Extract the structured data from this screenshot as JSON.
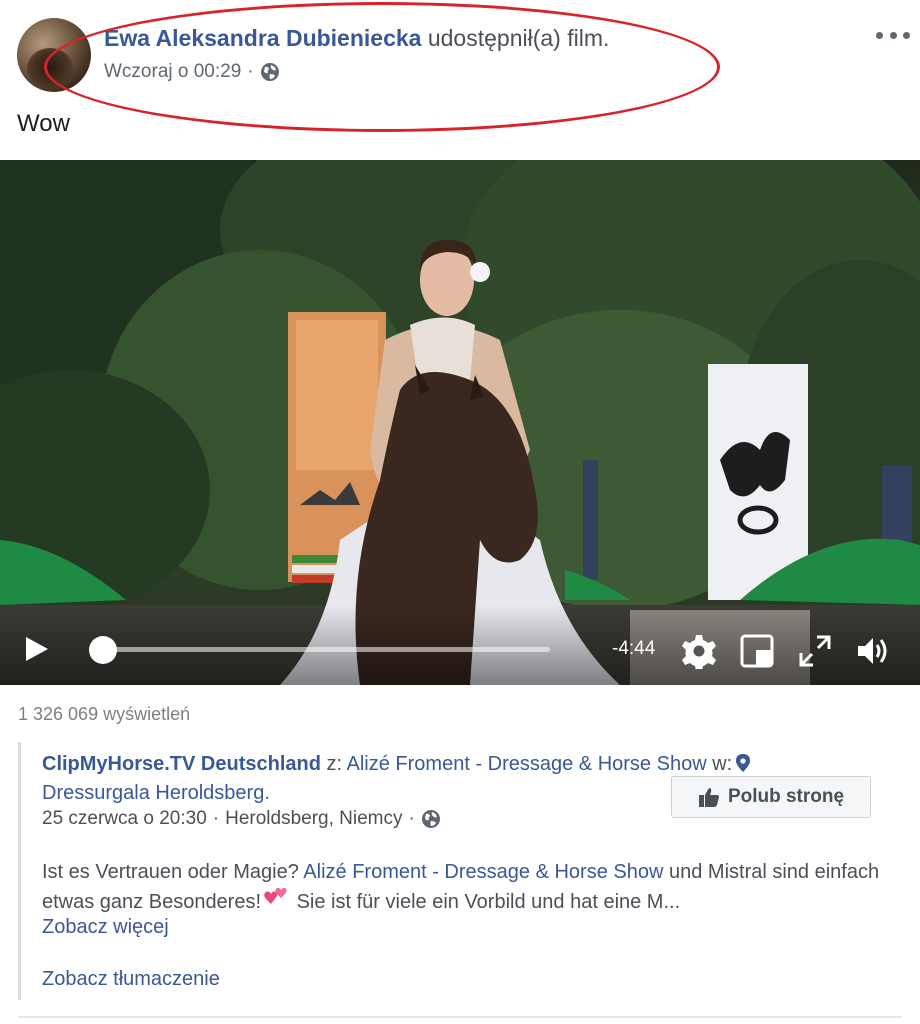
{
  "post": {
    "author": "Ewa Aleksandra Dubieniecka",
    "action": "udostępnił(a) film.",
    "timestamp": "Wczoraj o 00:29",
    "separator": "·",
    "privacy_icon": "globe-icon",
    "text": "Wow"
  },
  "video": {
    "time_remaining": "-4:44",
    "progress_fraction": 0.0,
    "icons": [
      "play-icon",
      "settings-icon",
      "picture-in-picture-icon",
      "fullscreen-icon",
      "volume-icon"
    ]
  },
  "views": "1 326 069 wyświetleń",
  "shared": {
    "page_name": "ClipMyHorse.TV Deutschland",
    "with_label": "z:",
    "with_name": "Alizé Froment - Dressage & Horse Show",
    "at_label": "w:",
    "location_name": "Dressurgala Heroldsberg",
    "location_suffix": ".",
    "date": "25 czerwca o 20:30",
    "separator": "·",
    "place": "Heroldsberg, Niemcy",
    "like_button": "Polub stronę",
    "desc_part1": "Ist es Vertrauen oder Magie?",
    "desc_link": "Alizé Froment - Dressage & Horse Show",
    "desc_part2": "und Mistral sind einfach etwas ganz Besonderes!",
    "desc_part3": "Sie ist für viele ein Vorbild und hat eine M...",
    "see_more": "Zobacz więcej",
    "see_translation": "Zobacz tłumaczenie"
  },
  "colors": {
    "link": "#385898",
    "annotation_oval": "#d9232a",
    "muted": "#606770"
  }
}
